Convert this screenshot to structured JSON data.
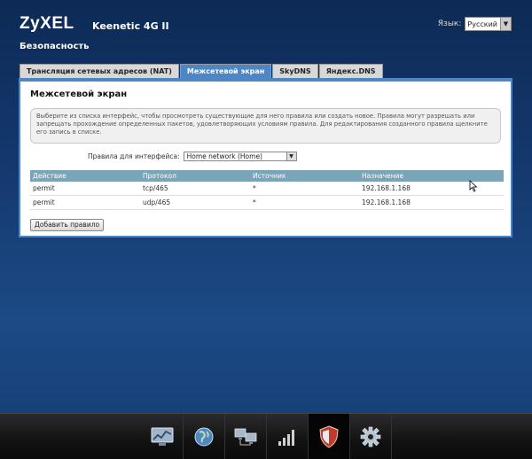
{
  "header": {
    "brand": "ZyXEL",
    "model": "Keenetic 4G II",
    "language_label": "Язык:",
    "language_value": "Русский"
  },
  "section_title": "Безопасность",
  "tabs": [
    {
      "label": "Трансляция сетевых адресов (NAT)"
    },
    {
      "label": "Межсетевой экран"
    },
    {
      "label": "SkyDNS"
    },
    {
      "label": "Яндекс.DNS"
    }
  ],
  "panel": {
    "title": "Межсетевой экран",
    "info": "Выберите из списка интерфейс, чтобы просмотреть существующие для него правила или создать новое. Правила могут разрешать или запрещать прохождение определенных пакетов, удовлетворяющих условиям правила. Для редактирования созданного правила щелкните его запись в списке.",
    "interface_label": "Правила для интерфейса:",
    "interface_value": "Home network (Home)",
    "columns": [
      "Действие",
      "Протокол",
      "Источник",
      "Назначение"
    ],
    "rows": [
      [
        "permit",
        "tcp/465",
        "*",
        "192.168.1.168"
      ],
      [
        "permit",
        "udp/465",
        "*",
        "192.168.1.168"
      ]
    ],
    "add_button": "Добавить правило"
  },
  "dock": [
    {
      "icon": "monitor-graph-icon"
    },
    {
      "icon": "globe-icon"
    },
    {
      "icon": "network-computers-icon"
    },
    {
      "icon": "signal-bars-icon"
    },
    {
      "icon": "shield-icon"
    },
    {
      "icon": "gear-icon"
    }
  ]
}
